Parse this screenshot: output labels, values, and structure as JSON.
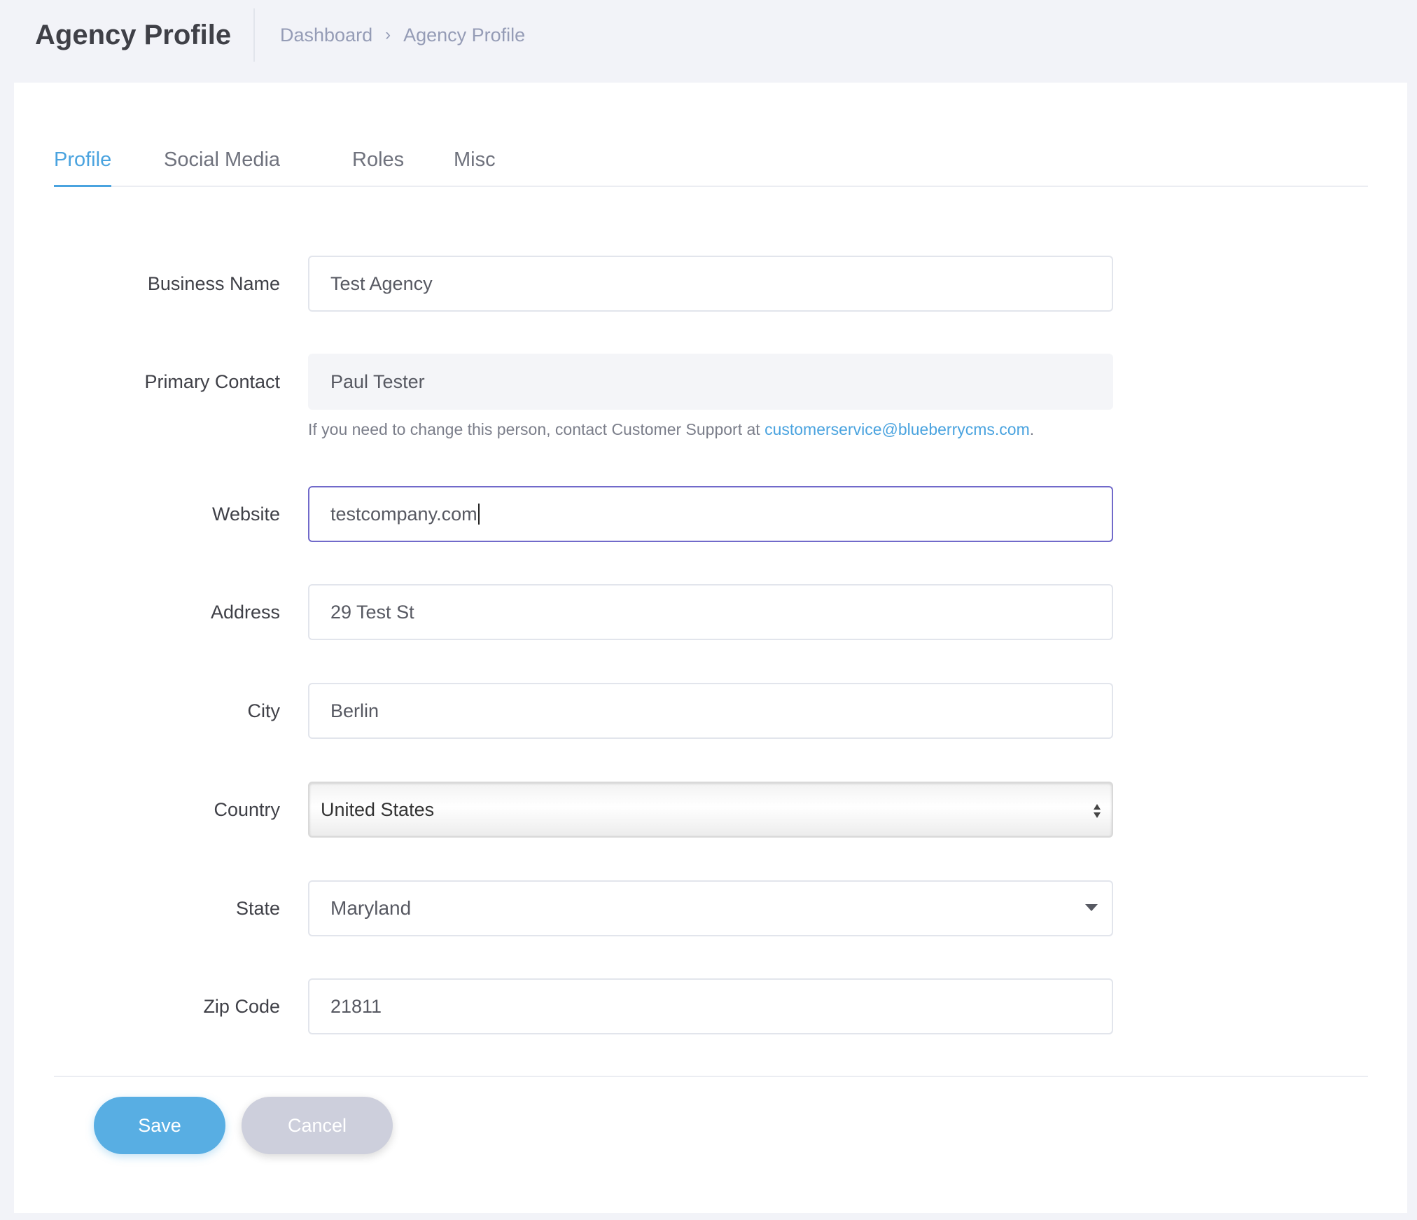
{
  "header": {
    "title": "Agency Profile",
    "breadcrumb": [
      "Dashboard",
      "Agency Profile"
    ],
    "breadcrumb_separator": "›"
  },
  "tabs": [
    {
      "label": "Profile",
      "active": true
    },
    {
      "label": "Social Media",
      "active": false
    },
    {
      "label": "Roles",
      "active": false
    },
    {
      "label": "Misc",
      "active": false
    }
  ],
  "form": {
    "business_name": {
      "label": "Business Name",
      "value": "Test Agency"
    },
    "primary_contact": {
      "label": "Primary Contact",
      "value": "Paul Tester",
      "help_text": "If you need to change this person, contact Customer Support at ",
      "help_email": "customerservice@blueberrycms.com",
      "help_suffix": "."
    },
    "website": {
      "label": "Website",
      "value": "testcompany.com"
    },
    "address": {
      "label": "Address",
      "value": "29 Test St"
    },
    "city": {
      "label": "City",
      "value": "Berlin"
    },
    "country": {
      "label": "Country",
      "value": "United States"
    },
    "state": {
      "label": "State",
      "value": "Maryland"
    },
    "zip": {
      "label": "Zip Code",
      "value": "21811"
    }
  },
  "actions": {
    "save_label": "Save",
    "cancel_label": "Cancel"
  },
  "colors": {
    "accent": "#4aa3df",
    "focus_border": "#716aca",
    "save_button": "#58aee3",
    "cancel_button": "#cdcfdc",
    "page_bg": "#f2f3f8"
  }
}
